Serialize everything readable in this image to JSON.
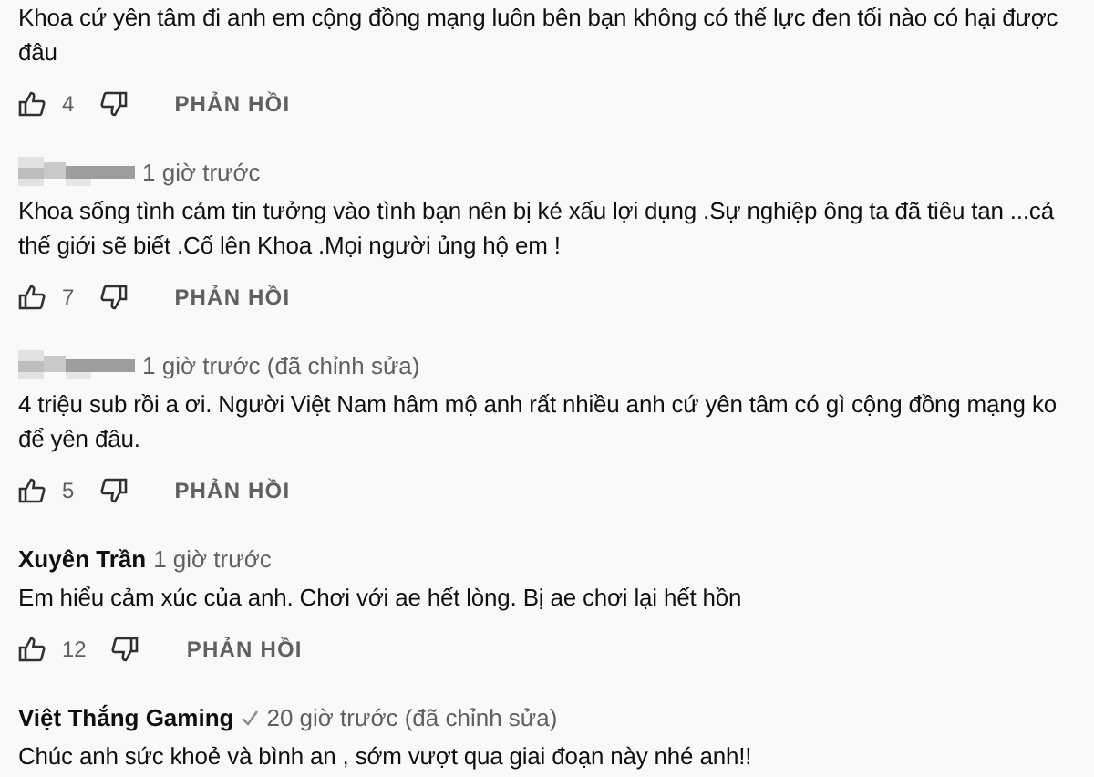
{
  "comments": [
    {
      "text": "Khoa cứ yên tâm đi anh em cộng đồng mạng luôn bên bạn không có thế lực đen tối nào có hại được đâu",
      "likes": "4",
      "reply": "PHẢN HỒI"
    },
    {
      "author": {
        "kind": "blurred"
      },
      "time": "1 giờ trước",
      "text": "Khoa sống tình cảm tin tưởng vào tình bạn nên bị kẻ xấu lợi dụng .Sự nghiệp ông ta đã tiêu tan ...cả thế giới sẽ biết .Cố lên Khoa .Mọi người ủng hộ em !",
      "likes": "7",
      "reply": "PHẢN HỒI"
    },
    {
      "author": {
        "kind": "blurred"
      },
      "time": "1 giờ trước (đã chỉnh sửa)",
      "text": "4 triệu sub rồi a ơi. Người Việt Nam hâm mộ anh rất nhiều anh cứ yên tâm có gì cộng đồng mạng ko để yên đâu.",
      "likes": "5",
      "reply": "PHẢN HỒI"
    },
    {
      "author": {
        "kind": "name",
        "name": "Xuyên Trần",
        "verified": false
      },
      "time": "1 giờ trước",
      "text": "Em hiểu cảm xúc của anh. Chơi với ae hết lòng. Bị ae chơi lại hết hồn",
      "likes": "12",
      "reply": "PHẢN HỒI"
    },
    {
      "author": {
        "kind": "name",
        "name": "Việt Thắng Gaming",
        "verified": true
      },
      "time": "20 giờ trước (đã chỉnh sửa)",
      "text": "Chúc anh sức khoẻ và bình an , sớm vượt qua giai đoạn này nhé anh!!"
    }
  ]
}
